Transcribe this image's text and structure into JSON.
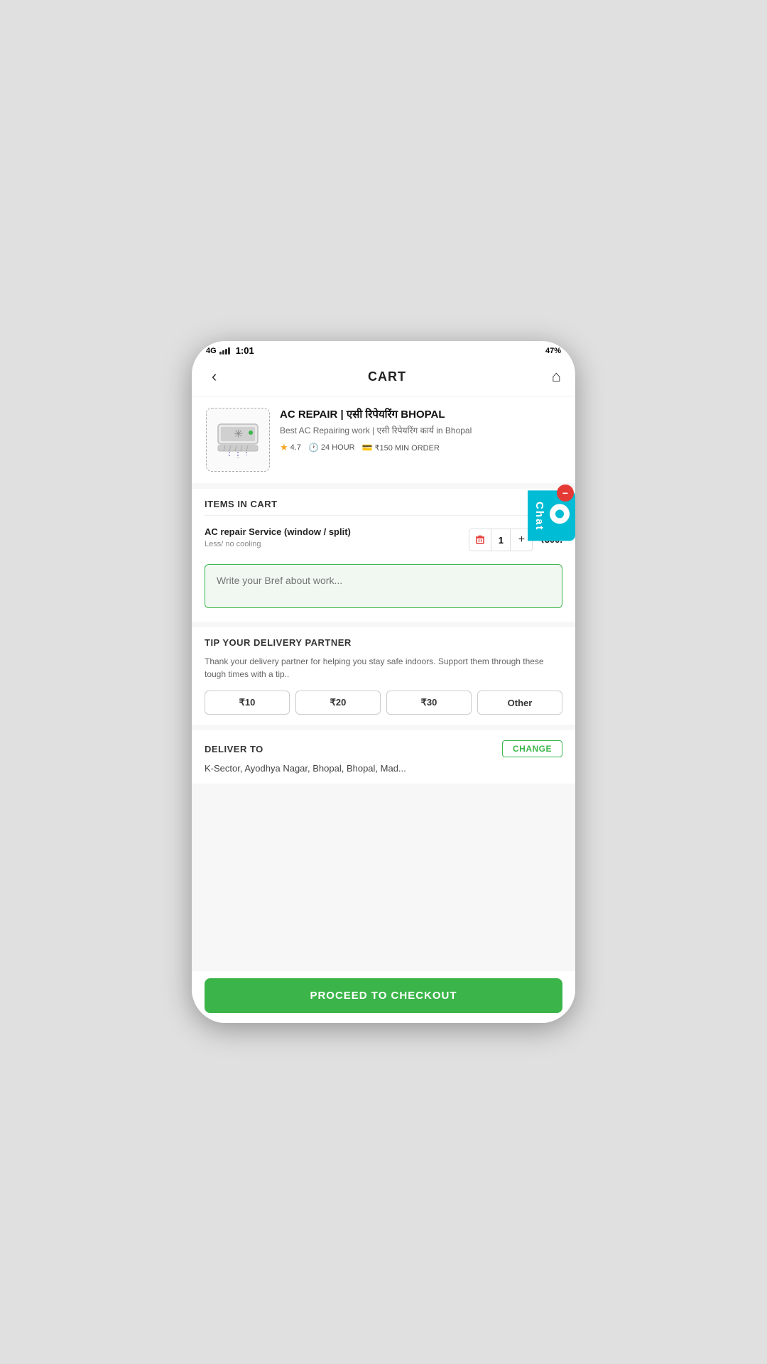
{
  "statusBar": {
    "time": "1:01",
    "network": "4G",
    "battery": "47"
  },
  "header": {
    "title": "CART",
    "backLabel": "‹",
    "homeIcon": "⌂"
  },
  "serviceCard": {
    "name": "AC REPAIR | एसी रिपेयरिंग BHOPAL",
    "description": "Best AC Repairing work | एसी रिपेयरिंग कार्य in Bhopal",
    "rating": "4.7",
    "hours": "24 HOUR",
    "minOrder": "₹150 MIN ORDER"
  },
  "cartSection": {
    "title": "ITEMS IN CART",
    "items": [
      {
        "name": "AC repair Service (window / split)",
        "sub": "Less/ no cooling",
        "quantity": "1",
        "price": "₹300."
      }
    ],
    "briefPlaceholder": "Write your Bref about work..."
  },
  "tipSection": {
    "title": "TIP YOUR DELIVERY PARTNER",
    "description": "Thank your delivery partner for helping you stay safe indoors. Support them through these tough times with a tip..",
    "options": [
      "₹10",
      "₹20",
      "₹30",
      "Other"
    ]
  },
  "deliverSection": {
    "title": "DELIVER TO",
    "changeLabel": "CHANGE",
    "address": "K-Sector, Ayodhya Nagar, Bhopal, Bhopal, Mad..."
  },
  "checkout": {
    "label": "PROCEED TO CHECKOUT"
  },
  "chat": {
    "label": "Chat",
    "badge": "−"
  },
  "colors": {
    "green": "#3bb54a",
    "cyan": "#00bcd4",
    "red": "#e53935",
    "star": "#f5a623"
  }
}
